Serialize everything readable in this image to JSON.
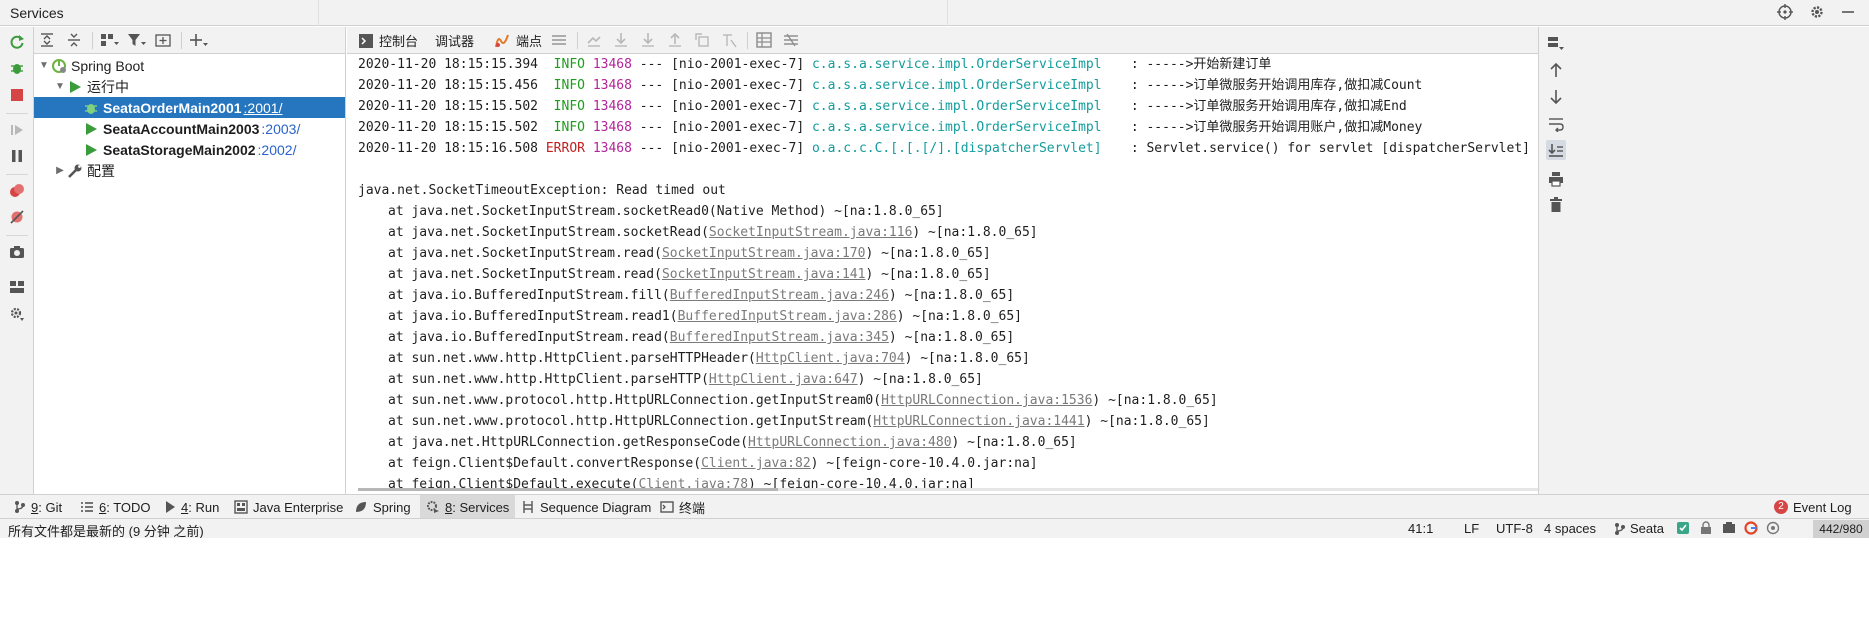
{
  "window": {
    "title": "Services"
  },
  "tree": {
    "root": {
      "label": "Spring Boot"
    },
    "running_group": {
      "label": "运行中"
    },
    "apps": [
      {
        "name": "SeataOrderMain2001",
        "port": ":2001/",
        "selected": true
      },
      {
        "name": "SeataAccountMain2003",
        "port": ":2003/",
        "selected": false
      },
      {
        "name": "SeataStorageMain2002",
        "port": ":2002/",
        "selected": false
      }
    ],
    "config_group": {
      "label": "配置"
    }
  },
  "console_toolbar": {
    "console_label": "控制台",
    "debugger_label": "调试器",
    "breakpoints_label": "端点"
  },
  "log_lines": [
    {
      "timestamp": "2020-11-20 18:15:15.394",
      "level": "INFO",
      "pid": "13468",
      "sep": "---",
      "thread": "[nio-2001-exec-7]",
      "logger": "c.a.s.a.service.impl.OrderServiceImpl",
      "message": ": ----->开始新建订单"
    },
    {
      "timestamp": "2020-11-20 18:15:15.456",
      "level": "INFO",
      "pid": "13468",
      "sep": "---",
      "thread": "[nio-2001-exec-7]",
      "logger": "c.a.s.a.service.impl.OrderServiceImpl",
      "message": ": ----->订单微服务开始调用库存,做扣减Count"
    },
    {
      "timestamp": "2020-11-20 18:15:15.502",
      "level": "INFO",
      "pid": "13468",
      "sep": "---",
      "thread": "[nio-2001-exec-7]",
      "logger": "c.a.s.a.service.impl.OrderServiceImpl",
      "message": ": ----->订单微服务开始调用库存,做扣减End"
    },
    {
      "timestamp": "2020-11-20 18:15:15.502",
      "level": "INFO",
      "pid": "13468",
      "sep": "---",
      "thread": "[nio-2001-exec-7]",
      "logger": "c.a.s.a.service.impl.OrderServiceImpl",
      "message": ": ----->订单微服务开始调用账户,做扣减Money"
    },
    {
      "timestamp": "2020-11-20 18:15:16.508",
      "level": "ERROR",
      "pid": "13468",
      "sep": "---",
      "thread": "[nio-2001-exec-7]",
      "logger": "o.a.c.c.C.[.[.[/].[dispatcherServlet]",
      "message": ": Servlet.service() for servlet [dispatcherServlet] in co"
    }
  ],
  "exception": "java.net.SocketTimeoutException: Read timed out",
  "stack_trace": [
    {
      "prefix": "at java.net.SocketInputStream.socketRead0(",
      "link": "",
      "suffix": "Native Method) ~[na:1.8.0_65]"
    },
    {
      "prefix": "at java.net.SocketInputStream.socketRead(",
      "link": "SocketInputStream.java:116",
      "suffix": ") ~[na:1.8.0_65]"
    },
    {
      "prefix": "at java.net.SocketInputStream.read(",
      "link": "SocketInputStream.java:170",
      "suffix": ") ~[na:1.8.0_65]"
    },
    {
      "prefix": "at java.net.SocketInputStream.read(",
      "link": "SocketInputStream.java:141",
      "suffix": ") ~[na:1.8.0_65]"
    },
    {
      "prefix": "at java.io.BufferedInputStream.fill(",
      "link": "BufferedInputStream.java:246",
      "suffix": ") ~[na:1.8.0_65]"
    },
    {
      "prefix": "at java.io.BufferedInputStream.read1(",
      "link": "BufferedInputStream.java:286",
      "suffix": ") ~[na:1.8.0_65]"
    },
    {
      "prefix": "at java.io.BufferedInputStream.read(",
      "link": "BufferedInputStream.java:345",
      "suffix": ") ~[na:1.8.0_65]"
    },
    {
      "prefix": "at sun.net.www.http.HttpClient.parseHTTPHeader(",
      "link": "HttpClient.java:704",
      "suffix": ") ~[na:1.8.0_65]"
    },
    {
      "prefix": "at sun.net.www.http.HttpClient.parseHTTP(",
      "link": "HttpClient.java:647",
      "suffix": ") ~[na:1.8.0_65]"
    },
    {
      "prefix": "at sun.net.www.protocol.http.HttpURLConnection.getInputStream0(",
      "link": "HttpURLConnection.java:1536",
      "suffix": ") ~[na:1.8.0_65]"
    },
    {
      "prefix": "at sun.net.www.protocol.http.HttpURLConnection.getInputStream(",
      "link": "HttpURLConnection.java:1441",
      "suffix": ") ~[na:1.8.0_65]"
    },
    {
      "prefix": "at java.net.HttpURLConnection.getResponseCode(",
      "link": "HttpURLConnection.java:480",
      "suffix": ") ~[na:1.8.0_65]"
    },
    {
      "prefix": "at feign.Client$Default.convertResponse(",
      "link": "Client.java:82",
      "suffix": ") ~[feign-core-10.4.0.jar:na]"
    },
    {
      "prefix": "at feign.Client$Default.execute(",
      "link": "Client.java:78",
      "suffix": ") ~[feign-core-10.4.0.jar:na]"
    }
  ],
  "bottom_tabs": [
    {
      "key": "9",
      "label": ": Git",
      "icon": "git-icon"
    },
    {
      "key": "6",
      "label": ": TODO",
      "icon": "todo-icon"
    },
    {
      "key": "4",
      "label": ": Run",
      "icon": "run-icon"
    },
    {
      "key": "",
      "label": "Java Enterprise",
      "icon": "java-enterprise-icon"
    },
    {
      "key": "",
      "label": "Spring",
      "icon": "spring-icon"
    },
    {
      "key": "8",
      "label": ": Services",
      "icon": "services-icon",
      "active": true
    },
    {
      "key": "",
      "label": "Sequence Diagram",
      "icon": "sequence-diagram-icon"
    },
    {
      "key": "",
      "label": "终端",
      "icon": "terminal-icon"
    }
  ],
  "event_log": {
    "count": "2",
    "label": "Event Log"
  },
  "status": {
    "message": "所有文件都是最新的 (9 分钟 之前)",
    "position": "41:1",
    "line_separator": "LF",
    "encoding": "UTF-8",
    "indent": "4 spaces",
    "vcs": "Seata",
    "memory": "442/980"
  },
  "colors": {
    "accent": "#2675bf",
    "info": "#1d9c1d",
    "error": "#c21f1f",
    "pid": "#b3239b",
    "logger": "#139c9c"
  }
}
